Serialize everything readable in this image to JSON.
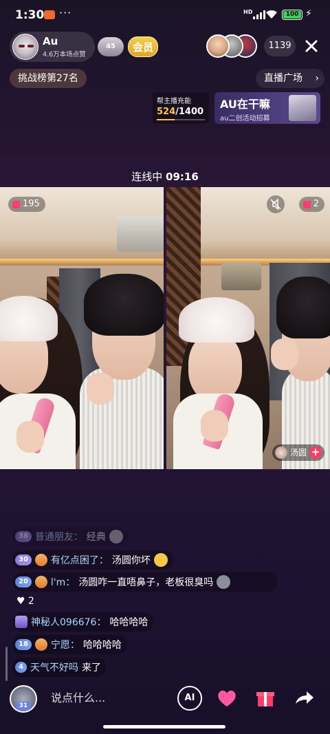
{
  "status_bar": {
    "time": "1:30",
    "more": "···",
    "signal_label": "HD",
    "battery": "100"
  },
  "host": {
    "name": "Au",
    "likes": "4.6万本场点赞",
    "fan_level": "45",
    "member_label": "会员"
  },
  "viewers": {
    "count": "1139"
  },
  "rank": {
    "label": "挑战榜第27名"
  },
  "plaza": {
    "label": "直播广场",
    "chevron": "›"
  },
  "charge": {
    "label": "帮主播充能",
    "current": "524",
    "total": "/1400",
    "progress": 0.374
  },
  "ad": {
    "title": "AU在干嘛",
    "subtitle": "au二创活动招募"
  },
  "connect": {
    "label": "连线中",
    "time": "09:16"
  },
  "left_pane": {
    "badge": "195"
  },
  "right_pane": {
    "badge": "2",
    "guest_name": "汤圆",
    "add": "+"
  },
  "chat": [
    {
      "level": "38",
      "name": "普通朋友：",
      "text": "经典"
    },
    {
      "level": "30",
      "fan": "",
      "name": "有亿点困了：",
      "text": "汤圆你坏"
    },
    {
      "level": "20",
      "fan": "",
      "name": "l'm：",
      "text": "汤圆咋一直唔鼻子，老板很臭吗"
    },
    {
      "heart": "♥ 2"
    },
    {
      "name": "神秘人096676：",
      "text": "哈哈哈哈"
    },
    {
      "level": "18",
      "fan": "",
      "name": "宁愿：",
      "text": "哈哈哈哈"
    },
    {
      "level": "4",
      "name": "天气不好吗",
      "text": "来了"
    }
  ],
  "input": {
    "placeholder": "说点什么...",
    "my_level": "31",
    "ai_label": "AI"
  },
  "colors": {
    "accent": "#ff3c6a",
    "name": "#a9d8ff",
    "gold": "#ffc44a"
  }
}
